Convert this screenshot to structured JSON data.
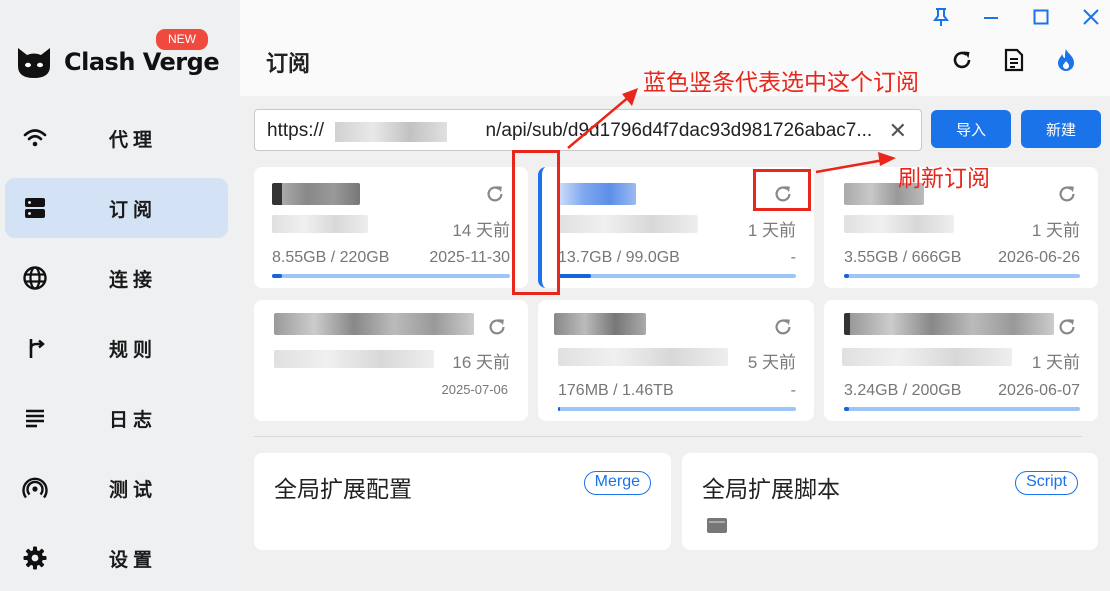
{
  "app": {
    "name": "Clash Verge",
    "badge": "NEW"
  },
  "sidebar": {
    "items": [
      {
        "label": "代理",
        "icon": "wifi-icon",
        "active": false
      },
      {
        "label": "订阅",
        "icon": "server-icon",
        "active": true
      },
      {
        "label": "连接",
        "icon": "globe-icon",
        "active": false
      },
      {
        "label": "规则",
        "icon": "route-icon",
        "active": false
      },
      {
        "label": "日志",
        "icon": "list-icon",
        "active": false
      },
      {
        "label": "测试",
        "icon": "radar-icon",
        "active": false
      },
      {
        "label": "设置",
        "icon": "gear-icon",
        "active": false
      }
    ]
  },
  "header": {
    "title": "订阅"
  },
  "import_bar": {
    "url_value": "https://                 n/api/sub/d9d1796d4f7dac93d981726abac7...",
    "import_label": "导入",
    "new_label": "新建"
  },
  "profiles": [
    {
      "time": "14 天前",
      "usage": "8.55GB / 220GB",
      "expire": "2025-11-30",
      "progress": 0.04,
      "selected": false
    },
    {
      "time": "1 天前",
      "usage": "13.7GB / 99.0GB",
      "expire": "-",
      "progress": 0.14,
      "selected": true
    },
    {
      "time": "1 天前",
      "usage": "3.55GB / 666GB",
      "expire": "2026-06-26",
      "progress": 0.02,
      "selected": false
    },
    {
      "time": "16 天前",
      "usage": "",
      "expire": "2025-07-06",
      "progress": null,
      "selected": false
    },
    {
      "time": "5 天前",
      "usage": "176MB / 1.46TB",
      "expire": "-",
      "progress": 0.01,
      "selected": false
    },
    {
      "time": "1 天前",
      "usage": "3.24GB / 200GB",
      "expire": "2026-06-07",
      "progress": 0.02,
      "selected": false
    }
  ],
  "extensions": {
    "config": {
      "title": "全局扩展配置",
      "badge": "Merge"
    },
    "script": {
      "title": "全局扩展脚本",
      "badge": "Script"
    }
  },
  "annotations": {
    "selected_note": "蓝色竖条代表选中这个订阅",
    "refresh_note": "刷新订阅"
  },
  "colors": {
    "accent": "#1a73e8",
    "active_nav": "#d4e2f5",
    "annotation": "#e8261c",
    "badge": "#f04a3f"
  }
}
